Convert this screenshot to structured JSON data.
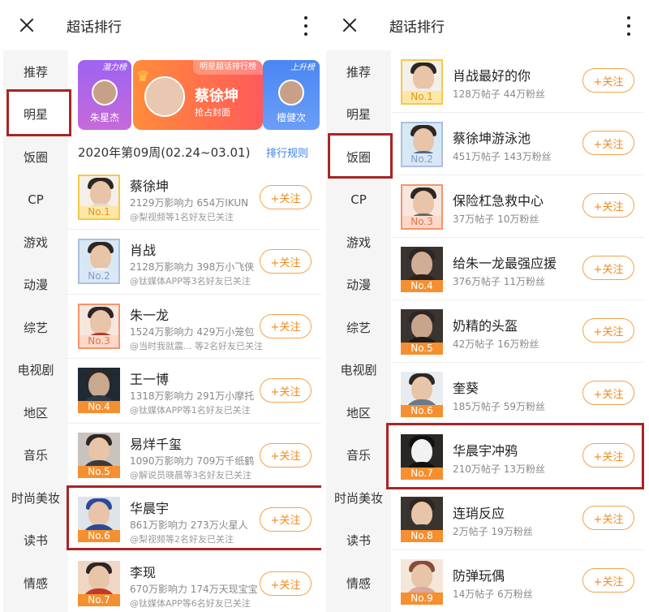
{
  "left": {
    "header": {
      "title": "超话排行"
    },
    "sidebar": {
      "items": [
        "推荐",
        "明星",
        "饭圈",
        "CP",
        "游戏",
        "动漫",
        "综艺",
        "电视剧",
        "地区",
        "音乐",
        "时尚美妆",
        "读书",
        "情感"
      ],
      "active": "明星"
    },
    "banner": {
      "potential_tag": "潜力榜",
      "potential_name": "朱星杰",
      "star_tag": "明星超话排行榜",
      "star_name": "蔡徐坤",
      "star_sub": "抢占封面",
      "rising_tag": "上升榜",
      "rising_name": "檀健次"
    },
    "week_label": "2020年第09周(02.24~03.01)",
    "rule_link": "排行规则",
    "rows": [
      {
        "rank": "No.1",
        "name": "蔡徐坤",
        "stat": "2129万影响力 654万IKUN",
        "friends": "@梨视频等1名好友已关注",
        "follow": "+关注"
      },
      {
        "rank": "No.2",
        "name": "肖战",
        "stat": "2128万影响力 398万小飞侠",
        "friends": "@钛媒体APP等3名好友已关注",
        "follow": "+关注"
      },
      {
        "rank": "No.3",
        "name": "朱一龙",
        "stat": "1524万影响力 429万小笼包",
        "friends": "@当时我就震...  等2名好友已关注",
        "follow": "+关注"
      },
      {
        "rank": "No.4",
        "name": "王一博",
        "stat": "1318万影响力 291万小摩托",
        "friends": "@钛媒体APP等1名好友已关注",
        "follow": "+关注"
      },
      {
        "rank": "No.5",
        "name": "易烊千玺",
        "stat": "1090万影响力 709万千纸鹤",
        "friends": "@解说员晓晨等3名好友已关注",
        "follow": "+关注"
      },
      {
        "rank": "No.6",
        "name": "华晨宇",
        "stat": "861万影响力 273万火星人",
        "friends": "@梨视频等2名好友已关注",
        "follow": "+关注"
      },
      {
        "rank": "No.7",
        "name": "李现",
        "stat": "670万影响力 174万天现宝宝",
        "friends": "@钛媒体APP等6名好友已关注",
        "follow": "+关注"
      }
    ]
  },
  "right": {
    "header": {
      "title": "超话排行"
    },
    "sidebar": {
      "items": [
        "推荐",
        "明星",
        "饭圈",
        "CP",
        "游戏",
        "动漫",
        "综艺",
        "电视剧",
        "地区",
        "音乐",
        "时尚美妆",
        "读书",
        "情感"
      ],
      "active": "饭圈"
    },
    "rows": [
      {
        "rank": "No.1",
        "name": "肖战最好的你",
        "stat": "128万帖子 44万粉丝",
        "follow": "+关注"
      },
      {
        "rank": "No.2",
        "name": "蔡徐坤游泳池",
        "stat": "451万帖子 143万粉丝",
        "follow": "+关注"
      },
      {
        "rank": "No.3",
        "name": "保险杠急救中心",
        "stat": "37万帖子 10万粉丝",
        "follow": "+关注"
      },
      {
        "rank": "No.4",
        "name": "给朱一龙最强应援",
        "stat": "376万帖子 11万粉丝",
        "follow": "+关注"
      },
      {
        "rank": "No.5",
        "name": "奶精的头盔",
        "stat": "42万帖子 16万粉丝",
        "follow": "+关注"
      },
      {
        "rank": "No.6",
        "name": "奎葵",
        "stat": "185万帖子 59万粉丝",
        "follow": "+关注"
      },
      {
        "rank": "No.7",
        "name": "华晨宇冲鸦",
        "stat": "210万帖子 13万粉丝",
        "follow": "+关注"
      },
      {
        "rank": "No.8",
        "name": "连琑反应",
        "stat": "2万帖子 19万粉丝",
        "follow": "+关注"
      },
      {
        "rank": "No.9",
        "name": "防弹玩偶",
        "stat": "14万帖子 6万粉丝",
        "follow": "+关注"
      }
    ]
  },
  "colors": {
    "highlight_box": "#a92524",
    "follow_orange": "#f08a1c",
    "link_blue": "#3d7fe0"
  },
  "icons": {
    "close": "close-icon",
    "more": "more-vertical-icon",
    "crown": "crown-icon"
  }
}
